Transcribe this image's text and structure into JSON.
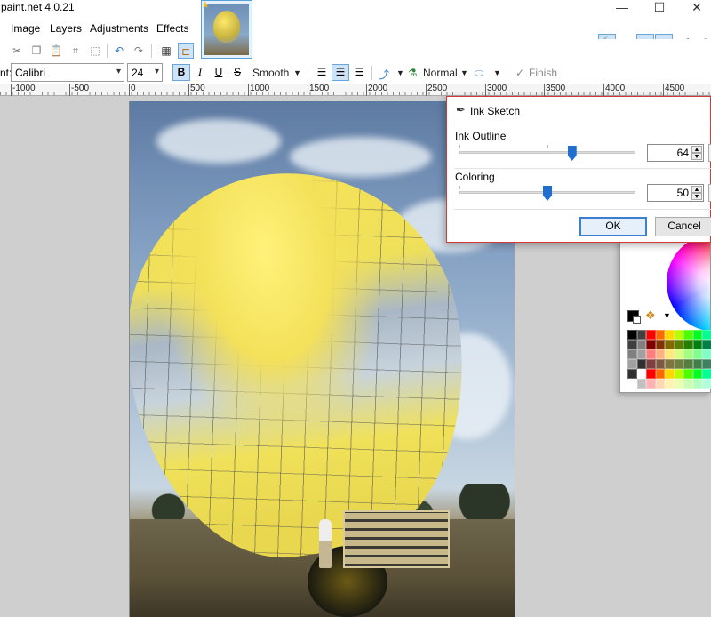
{
  "app": {
    "title": "paint.net 4.0.21"
  },
  "window_controls": {
    "minimize": "—",
    "maximize": "☐",
    "close": "✕"
  },
  "menu": {
    "items": [
      "Image",
      "Layers",
      "Adjustments",
      "Effects"
    ]
  },
  "toolbar_text": {
    "font_label": "nt:",
    "font_value": "Calibri",
    "size_value": "24",
    "bold": "B",
    "italic": "I",
    "underline": "U",
    "strike": "S",
    "antialias": "Smooth",
    "blend_mode": "Normal",
    "finish": "Finish"
  },
  "ruler": {
    "labels": [
      "-1000",
      "-500",
      "0",
      "500",
      "1000",
      "1500",
      "2000",
      "2500",
      "3000",
      "3500",
      "4000",
      "4500"
    ]
  },
  "dialog": {
    "title": "Ink Sketch",
    "ink_outline_label": "Ink Outline",
    "ink_outline_value": "64",
    "ink_outline_level": 0.64,
    "coloring_label": "Coloring",
    "coloring_value": "50",
    "coloring_level": 0.5,
    "ok_label": "OK",
    "cancel_label": "Cancel"
  },
  "colors": {
    "primary": "#000000",
    "secondary": "#ffffff",
    "accent": "#1f6fd1",
    "dialog_border": "#d23a3a"
  },
  "icons": {
    "history": "clock-icon",
    "layers": "layers-icon",
    "colors": "color-wheel-icon",
    "settings": "gear-icon",
    "help": "help-icon",
    "tools": "hammer-icon"
  }
}
